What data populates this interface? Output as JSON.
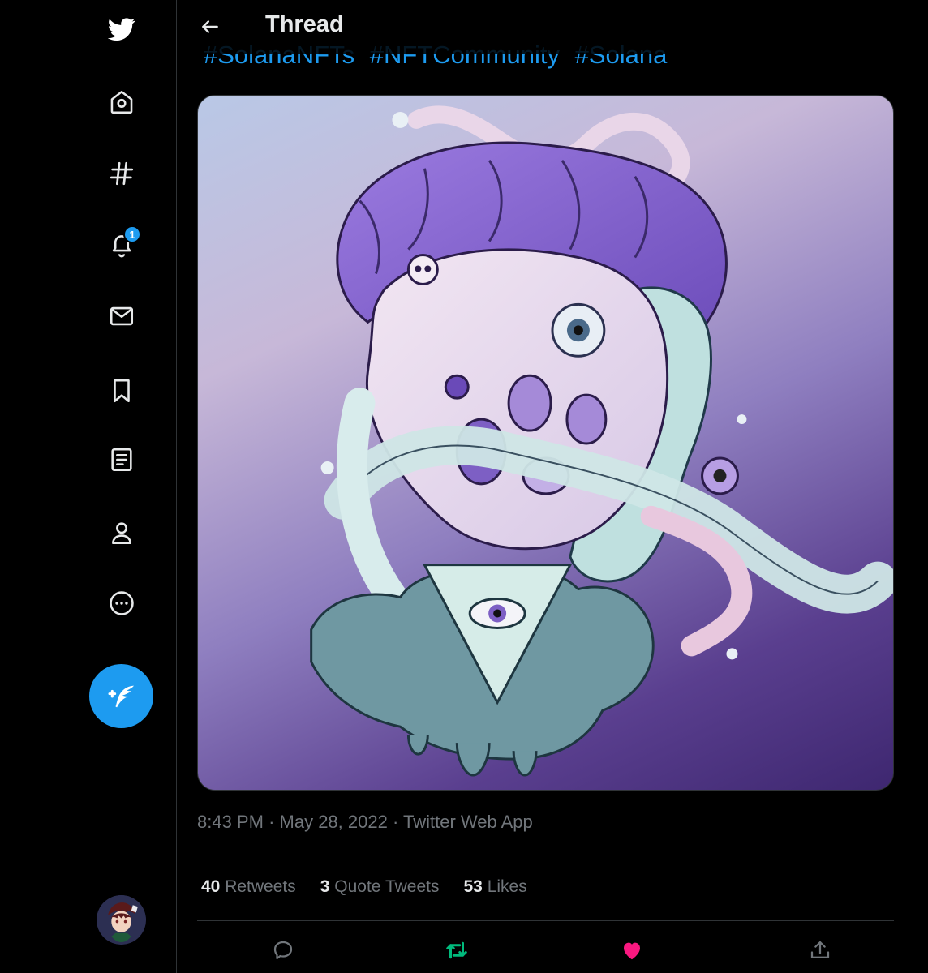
{
  "header": {
    "title": "Thread"
  },
  "tweet": {
    "hashtags": [
      "#SolanaNFTs",
      "#NFTCommunity",
      "#Solana"
    ],
    "time": "8:43 PM",
    "separator": "·",
    "date": "May 28, 2022",
    "source": "Twitter Web App"
  },
  "stats": {
    "retweets": {
      "count": "40",
      "label": "Retweets"
    },
    "quotes": {
      "count": "3",
      "label": "Quote Tweets"
    },
    "likes": {
      "count": "53",
      "label": "Likes"
    }
  },
  "sidebar": {
    "notification_badge": "1",
    "items": [
      "twitter-logo",
      "home-icon",
      "explore-hash-icon",
      "bell-icon",
      "mail-icon",
      "bookmark-icon",
      "lists-icon",
      "profile-icon",
      "more-icon"
    ]
  },
  "colors": {
    "accent": "#1d9bf0",
    "retweet_active": "#00ba7c",
    "like_active": "#f91880",
    "muted": "#71767b"
  }
}
